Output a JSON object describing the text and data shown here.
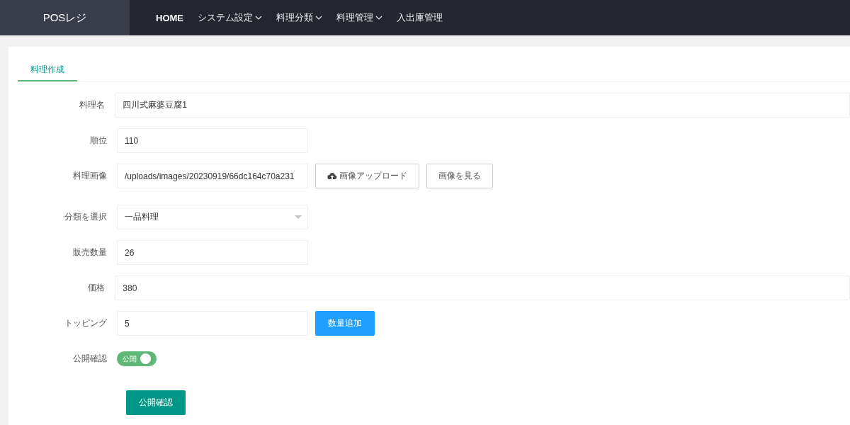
{
  "header": {
    "logo": "POSレジ",
    "nav": [
      {
        "label": "HOME",
        "dropdown": false,
        "selected": true
      },
      {
        "label": "システム設定",
        "dropdown": true,
        "selected": false
      },
      {
        "label": "料理分類",
        "dropdown": true,
        "selected": false
      },
      {
        "label": "料理管理",
        "dropdown": true,
        "selected": false
      },
      {
        "label": "入出庫管理",
        "dropdown": false,
        "selected": false
      }
    ]
  },
  "tabs": [
    {
      "label": "料理作成",
      "selected": true
    }
  ],
  "form": {
    "fields": [
      {
        "kind": "wide",
        "label": "料理名",
        "value": "四川式麻婆豆腐1"
      },
      {
        "kind": "text",
        "label": "順位",
        "value": "110"
      },
      {
        "kind": "image",
        "label": "料理画像",
        "value": "/uploads/images/20230919/66dc164c70a231",
        "buttons": [
          "画像アップロード",
          "画像を見る"
        ]
      },
      {
        "kind": "select",
        "label": "分類を選択",
        "value": "一品料理"
      },
      {
        "kind": "text",
        "label": "販売数量",
        "value": "26"
      },
      {
        "kind": "wide",
        "label": "価格",
        "value": "380"
      },
      {
        "kind": "addable",
        "label": "トッピング",
        "value": "5",
        "button": "数量追加"
      },
      {
        "kind": "switch",
        "label": "公開確認",
        "switch_text": "公開",
        "on": true
      }
    ],
    "submit": "公開確認"
  }
}
